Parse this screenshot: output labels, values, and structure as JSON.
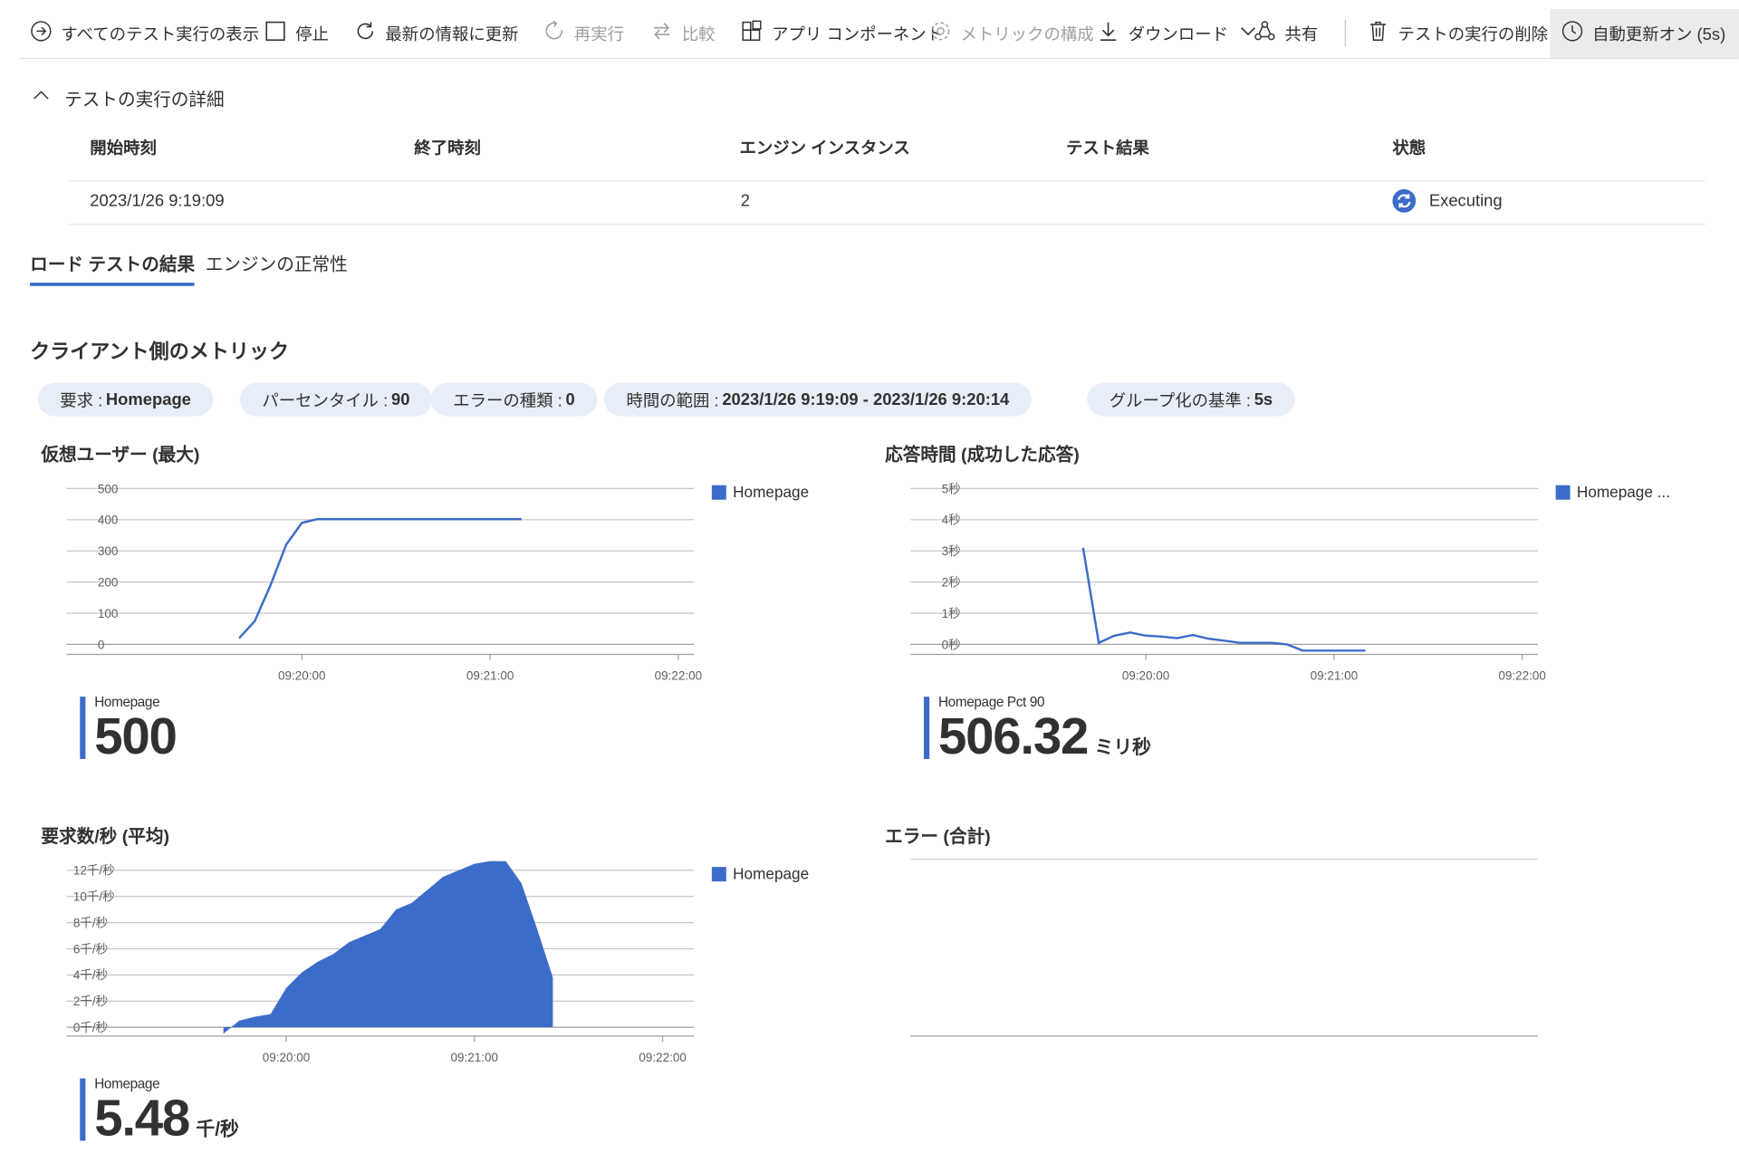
{
  "toolbar": {
    "items": [
      {
        "label": "すべてのテスト実行の表示",
        "icon": "arrow-circle-right-icon"
      },
      {
        "label": "停止",
        "icon": "stop-icon"
      },
      {
        "label": "最新の情報に更新",
        "icon": "refresh-icon"
      },
      {
        "label": "再実行",
        "icon": "rerun-icon",
        "disabled": true
      },
      {
        "label": "比較",
        "icon": "compare-icon",
        "disabled": true
      },
      {
        "label": "アプリ コンポーネント",
        "icon": "app-components-icon"
      },
      {
        "label": "メトリックの構成",
        "icon": "gear-icon",
        "disabled": true
      },
      {
        "label": "ダウンロード",
        "icon": "download-icon"
      },
      {
        "label": "共有",
        "icon": "share-icon"
      },
      {
        "label": "テストの実行の削除",
        "icon": "trash-icon"
      },
      {
        "label": "自動更新オン (5s)",
        "icon": "clock-icon",
        "active": true
      }
    ]
  },
  "details": {
    "section_title": "テストの実行の詳細",
    "headers": [
      "開始時刻",
      "終了時刻",
      "エンジン インスタンス",
      "テスト結果",
      "状態"
    ],
    "row": {
      "start": "2023/1/26 9:19:09",
      "end": "",
      "engines": "2",
      "result": "",
      "status": "Executing"
    }
  },
  "tabs": [
    "ロード テストの結果",
    "エンジンの正常性"
  ],
  "active_tab": 0,
  "metrics_title": "クライアント側のメトリック",
  "filters": [
    {
      "label": "要求 :",
      "value": "Homepage"
    },
    {
      "label": "パーセンタイル :",
      "value": "90"
    },
    {
      "label": "エラーの種類 :",
      "value": "0"
    },
    {
      "label": "時間の範囲 :",
      "value": "2023/1/26 9:19:09 - 2023/1/26 9:20:14"
    },
    {
      "label": "グループ化の基準 :",
      "value": "5s"
    }
  ],
  "colors": {
    "accent": "#3b6cc9"
  },
  "chart_data": [
    {
      "type": "line",
      "title": "仮想ユーザー (最大)",
      "y_ticks": [
        "500",
        "400",
        "300",
        "200",
        "100",
        "0"
      ],
      "x_ticks": [
        "09:20:00",
        "09:21:00",
        "09:22:00"
      ],
      "ylim": [
        0,
        500
      ],
      "x_range_seconds": [
        -75,
        125
      ],
      "series": [
        {
          "name": "Homepage",
          "x": [
            -20,
            -15,
            -10,
            -5,
            0,
            5,
            10,
            20,
            30,
            40,
            50,
            60,
            70
          ],
          "y": [
            20,
            75,
            190,
            320,
            390,
            402,
            402,
            402,
            402,
            402,
            402,
            402,
            402
          ]
        }
      ],
      "legend": [
        "Homepage"
      ],
      "kpi": {
        "label": "Homepage",
        "value": "500",
        "unit": ""
      }
    },
    {
      "type": "line",
      "title": "応答時間 (成功した応答)",
      "y_ticks": [
        "5秒",
        "4秒",
        "3秒",
        "2秒",
        "1秒",
        "0秒"
      ],
      "x_ticks": [
        "09:20:00",
        "09:21:00",
        "09:22:00"
      ],
      "ylim": [
        0,
        5
      ],
      "x_range_seconds": [
        -75,
        125
      ],
      "series": [
        {
          "name": "Homepage Pct 90",
          "x": [
            -20,
            -15,
            -10,
            -5,
            0,
            5,
            10,
            15,
            20,
            25,
            30,
            35,
            40,
            45,
            50,
            55,
            60,
            65,
            70
          ],
          "y": [
            3.1,
            0.05,
            0.28,
            0.38,
            0.28,
            0.25,
            0.2,
            0.3,
            0.18,
            0.12,
            0.05,
            0.05,
            0.05,
            0.0,
            -0.2,
            -0.2,
            -0.2,
            -0.2,
            -0.2
          ]
        }
      ],
      "legend": [
        "Homepage ..."
      ],
      "kpi": {
        "label": "Homepage Pct 90",
        "value": "506.32",
        "unit": "ミリ秒"
      }
    },
    {
      "type": "area",
      "title": "要求数/秒 (平均)",
      "y_ticks": [
        "12千/秒",
        "10千/秒",
        "8千/秒",
        "6千/秒",
        "4千/秒",
        "2千/秒",
        "0千/秒"
      ],
      "x_ticks": [
        "09:20:00",
        "09:21:00",
        "09:22:00"
      ],
      "ylim": [
        0,
        12
      ],
      "x_range_seconds": [
        -70,
        130
      ],
      "series": [
        {
          "name": "Homepage",
          "x": [
            -20,
            -15,
            -10,
            -5,
            0,
            5,
            10,
            15,
            20,
            25,
            30,
            35,
            40,
            45,
            50,
            55,
            60,
            65,
            70,
            75,
            80,
            85
          ],
          "y": [
            -0.5,
            0.5,
            0.8,
            1.0,
            3.0,
            4.2,
            5.0,
            5.6,
            6.5,
            7.0,
            7.5,
            9.0,
            9.5,
            10.5,
            11.5,
            12.0,
            12.5,
            12.7,
            12.7,
            11.0,
            7.5,
            3.8
          ]
        }
      ],
      "legend": [
        "Homepage"
      ],
      "kpi": {
        "label": "Homepage",
        "value": "5.48",
        "unit": "千/秒"
      }
    },
    {
      "type": "line",
      "title": "エラー (合計)",
      "series": []
    }
  ]
}
